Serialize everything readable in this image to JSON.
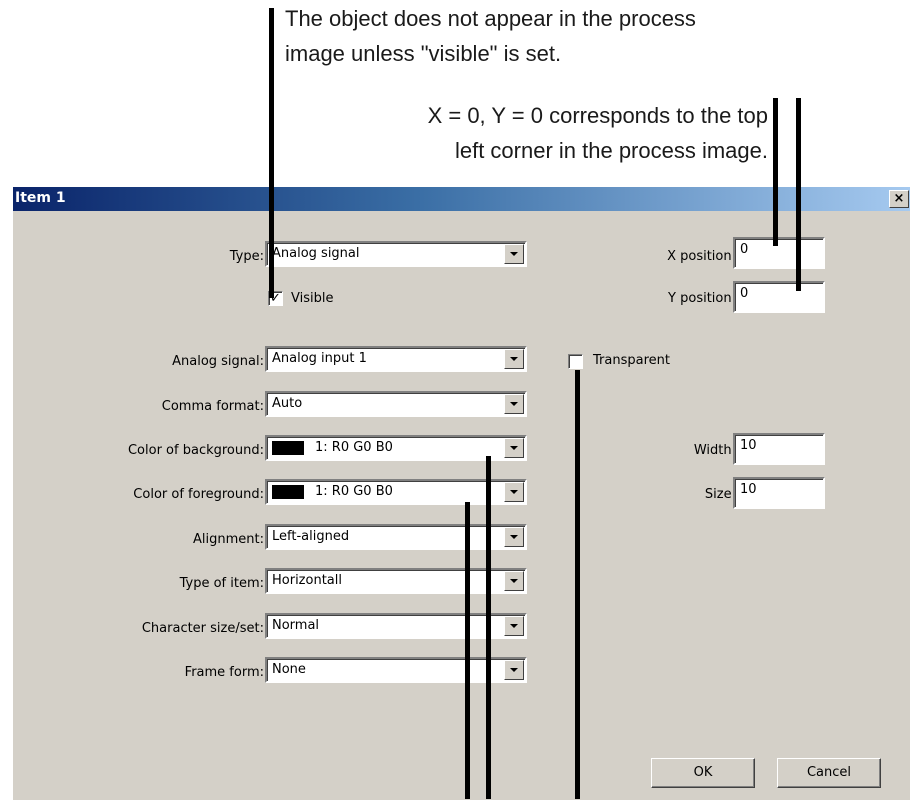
{
  "callouts": {
    "visible_note": "The object does not appear in the process image unless \"visible\" is set.",
    "visible_note_line1": "The object does not appear in the process",
    "visible_note_line2": "image unless \"visible\" is set.",
    "origin_note_line1": "X = 0, Y = 0 corresponds to the top",
    "origin_note_line2": "left corner in the process image."
  },
  "dialog": {
    "title": "Item 1",
    "close_label": "×",
    "fields": {
      "type": {
        "label": "Type:",
        "value": "Analog signal"
      },
      "visible": {
        "label": "Visible",
        "checked": true,
        "mark": "✓"
      },
      "analog_signal": {
        "label": "Analog signal:",
        "value": "Analog input 1"
      },
      "comma_format": {
        "label": "Comma format:",
        "value": "Auto"
      },
      "color_background": {
        "label": "Color of background:",
        "value": "1: R0 G0 B0",
        "swatch": "#000000"
      },
      "color_foreground": {
        "label": "Color of foreground:",
        "value": "1: R0 G0 B0",
        "swatch": "#000000"
      },
      "alignment": {
        "label": "Alignment:",
        "value": "Left-aligned"
      },
      "type_of_item": {
        "label": "Type of item:",
        "value": "Horizontall"
      },
      "character_size": {
        "label": "Character size/set:",
        "value": "Normal"
      },
      "frame_form": {
        "label": "Frame form:",
        "value": "None"
      }
    },
    "right": {
      "x_position": {
        "label": "X position:",
        "value": "0"
      },
      "y_position": {
        "label": "Y position:",
        "value": "0"
      },
      "transparent": {
        "label": "Transparent",
        "checked": false
      },
      "width": {
        "label": "Width:",
        "value": "10"
      },
      "size": {
        "label": "Size:",
        "value": "10"
      }
    },
    "buttons": {
      "ok": "OK",
      "cancel": "Cancel"
    }
  },
  "colors": {
    "dialog_bg": "#d4d0c8",
    "title_start": "#0a246a",
    "title_end": "#a6caf0"
  }
}
